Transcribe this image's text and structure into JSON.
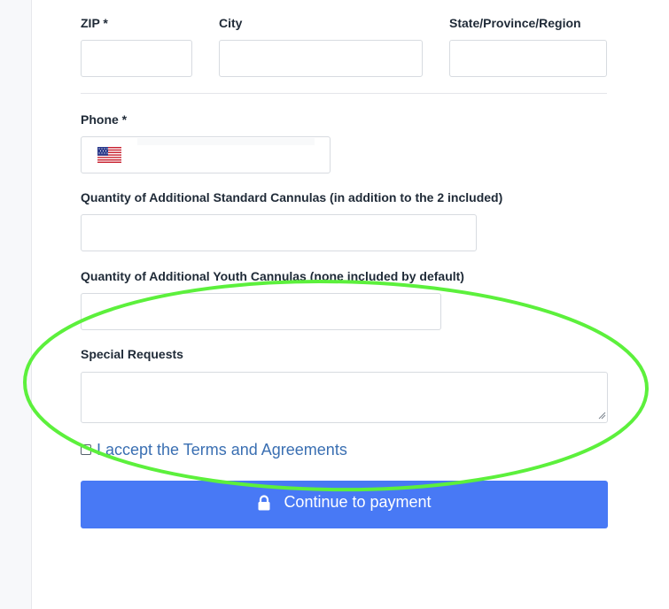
{
  "address": {
    "zip_label": "ZIP *",
    "city_label": "City",
    "state_label": "State/Province/Region"
  },
  "phone": {
    "label": "Phone *",
    "country_flag": "us-flag-icon"
  },
  "cannulas": {
    "standard_label": "Quantity of Additional Standard Cannulas (in addition to the 2 included)",
    "youth_label": "Quantity of Additional Youth Cannulas (none included by default)"
  },
  "special_requests": {
    "label": "Special Requests"
  },
  "terms": {
    "label": "I accept the Terms and Agreements",
    "checked": false
  },
  "submit": {
    "label": "Continue to payment",
    "icon": "lock-icon"
  },
  "colors": {
    "button_bg": "#4879f5",
    "link_text": "#3a6fb2",
    "annotation_stroke": "#5cf03c"
  }
}
